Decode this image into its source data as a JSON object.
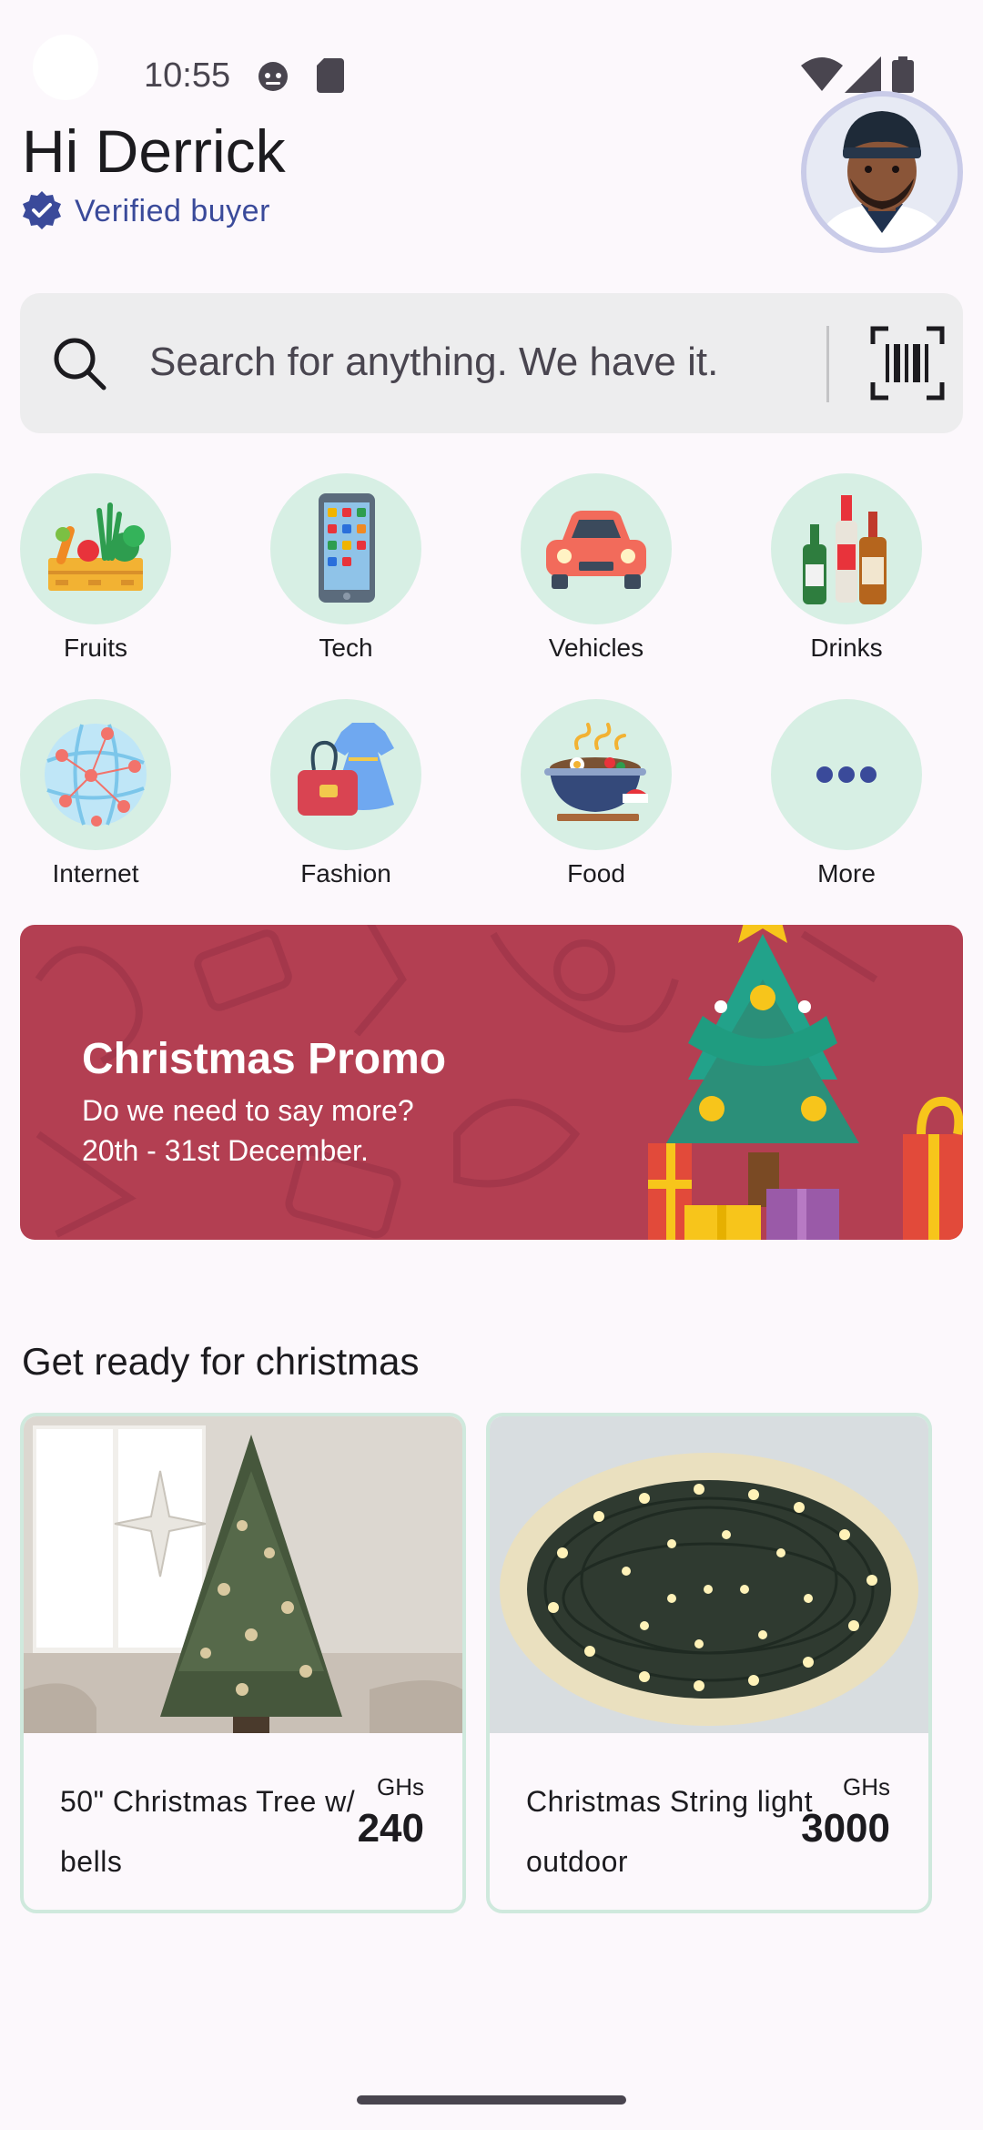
{
  "status_bar": {
    "time": "10:55"
  },
  "header": {
    "greeting": "Hi Derrick",
    "verified_label": "Verified buyer"
  },
  "search": {
    "placeholder": "Search for anything. We have it."
  },
  "categories": [
    {
      "label": "Fruits",
      "icon": "fruits-crate-icon"
    },
    {
      "label": "Tech",
      "icon": "smartphone-icon"
    },
    {
      "label": "Vehicles",
      "icon": "car-icon"
    },
    {
      "label": "Drinks",
      "icon": "bottles-icon"
    },
    {
      "label": "Internet",
      "icon": "globe-network-icon"
    },
    {
      "label": "Fashion",
      "icon": "dress-bag-icon"
    },
    {
      "label": "Food",
      "icon": "food-bowl-icon"
    },
    {
      "label": "More",
      "icon": "more-dots-icon"
    }
  ],
  "promo": {
    "title": "Christmas Promo",
    "subtitle_line1": "Do we need to say more?",
    "subtitle_line2": "20th - 31st December."
  },
  "section": {
    "title": "Get ready for christmas",
    "products": [
      {
        "name": "50\" Christmas Tree w/ bells",
        "currency": "GHs",
        "price": "240"
      },
      {
        "name": "Christmas String light outdoor",
        "currency": "GHs",
        "price": "3000"
      }
    ]
  },
  "colors": {
    "background": "#fcf8fc",
    "accent": "#3a4a9a",
    "category_bg": "#d7efe4",
    "promo_bg": "#b33f52",
    "card_border": "#cfe9dd"
  }
}
